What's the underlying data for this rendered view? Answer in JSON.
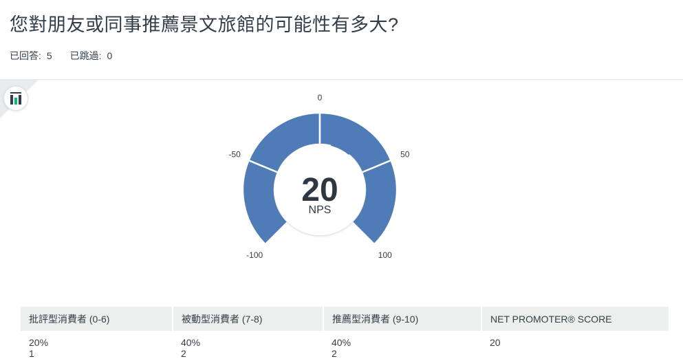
{
  "question": {
    "title": "您對朋友或同事推薦景文旅館的可能性有多大?",
    "answered_label": "已回答:",
    "answered_value": "5",
    "skipped_label": "已跳過:",
    "skipped_value": "0"
  },
  "badge": {
    "icon": "bar-chart-icon"
  },
  "chart_data": {
    "type": "gauge",
    "min": -100,
    "max": 100,
    "value": 20,
    "value_label": "NPS",
    "tick_labels": [
      "-100",
      "-50",
      "0",
      "50",
      "100"
    ],
    "color": "#4f7cb7"
  },
  "table": {
    "headers": [
      "批評型消費者 (0-6)",
      "被動型消費者 (7-8)",
      "推薦型消費者 (9-10)",
      "NET PROMOTER® SCORE"
    ],
    "rows": [
      {
        "percent": "20%",
        "count": "1"
      },
      {
        "percent": "40%",
        "count": "2"
      },
      {
        "percent": "40%",
        "count": "2"
      },
      {
        "percent": "20",
        "count": ""
      }
    ]
  }
}
